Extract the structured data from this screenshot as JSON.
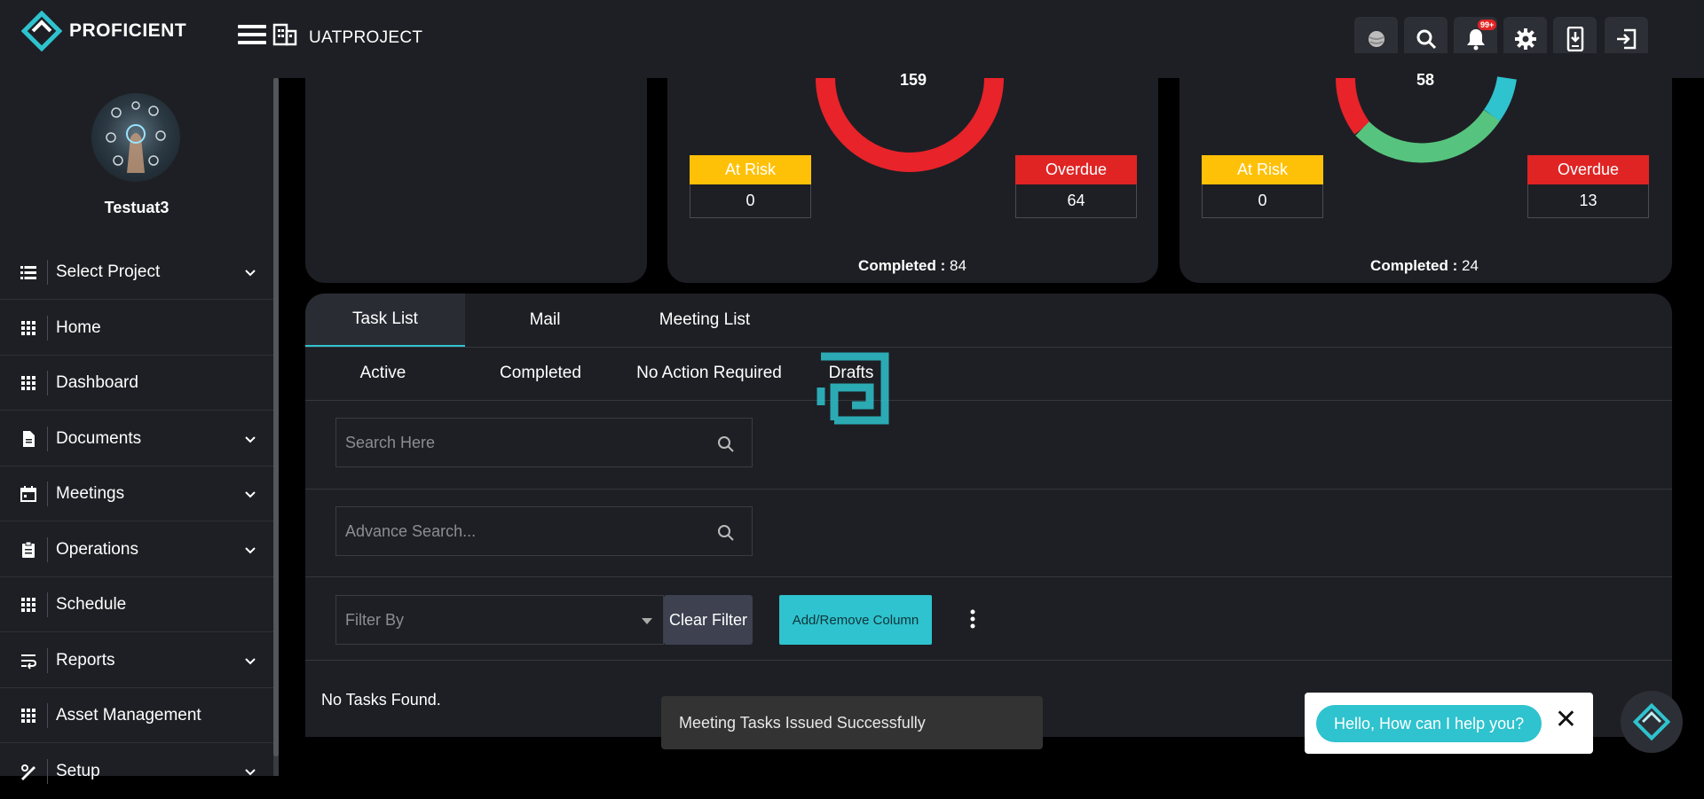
{
  "header": {
    "brand": "PROFICIENT",
    "project_name": "UATPROJECT",
    "notification_count": "99+"
  },
  "sidebar": {
    "username": "Testuat3",
    "items": [
      {
        "label": "Select Project",
        "icon": "list-icon",
        "has_chevron": true
      },
      {
        "label": "Home",
        "icon": "grid-icon",
        "has_chevron": false
      },
      {
        "label": "Dashboard",
        "icon": "grid-icon",
        "has_chevron": false
      },
      {
        "label": "Documents",
        "icon": "document-icon",
        "has_chevron": true
      },
      {
        "label": "Meetings",
        "icon": "calendar-icon",
        "has_chevron": true
      },
      {
        "label": "Operations",
        "icon": "clipboard-icon",
        "has_chevron": true
      },
      {
        "label": "Schedule",
        "icon": "grid-icon",
        "has_chevron": false
      },
      {
        "label": "Reports",
        "icon": "wrap-text-icon",
        "has_chevron": true
      },
      {
        "label": "Asset Management",
        "icon": "grid-icon",
        "has_chevron": false
      },
      {
        "label": "Setup",
        "icon": "setup-icon",
        "has_chevron": true
      }
    ]
  },
  "cards": [
    {
      "gauge_value": "159",
      "at_risk_label": "At Risk",
      "at_risk_value": "0",
      "overdue_label": "Overdue",
      "overdue_value": "64",
      "completed_label": "Completed :",
      "completed_value": "84"
    },
    {
      "gauge_value": "58",
      "at_risk_label": "At Risk",
      "at_risk_value": "0",
      "overdue_label": "Overdue",
      "overdue_value": "13",
      "completed_label": "Completed :",
      "completed_value": "24"
    }
  ],
  "tabs": [
    "Task List",
    "Mail",
    "Meeting List"
  ],
  "subtabs": [
    "Active",
    "Completed",
    "No Action Required",
    "Drafts"
  ],
  "search": {
    "placeholder": "Search Here"
  },
  "advance_search": {
    "placeholder": "Advance Search..."
  },
  "filter": {
    "placeholder": "Filter By"
  },
  "buttons": {
    "clear_filter": "Clear Filter",
    "add_remove_column": "Add/Remove Column"
  },
  "empty_message": "No Tasks Found.",
  "toast": "Meeting Tasks Issued Successfully",
  "chat": {
    "greeting": "Hello, How can I help you?"
  },
  "colors": {
    "accent": "#2ec3ce",
    "at_risk": "#ffc107",
    "overdue": "#e02424",
    "gauge_red": "#e8232a",
    "gauge_green": "#56c47e",
    "gauge_teal": "#2ec3ce"
  }
}
